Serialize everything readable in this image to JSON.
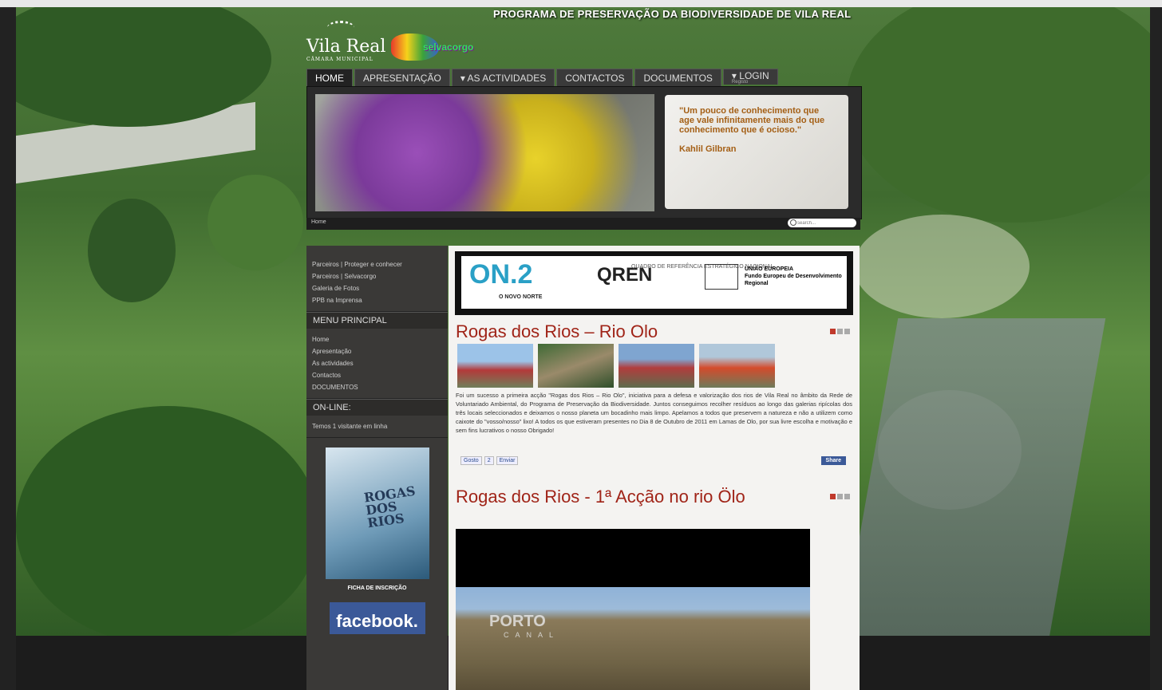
{
  "banner": {
    "title": "PROGRAMA DE PRESERVAÇÃO DA BIODIVERSIDADE DE VILA REAL"
  },
  "logos": {
    "vila_real": "Vila Real",
    "vila_real_sub": "CÂMARA MUNICIPAL",
    "selvacorgo": "selvacorgo"
  },
  "nav": {
    "home": "HOME",
    "apresentacao": "APRESENTAÇÃO",
    "actividades": "AS ACTIVIDADES",
    "contactos": "CONTACTOS",
    "documentos": "DOCUMENTOS",
    "login": "LOGIN",
    "login_sub": "Registo",
    "dropdown_mark": "▾"
  },
  "quote": {
    "text": "\"Um pouco de conhecimento que age vale infinitamente mais do que conhecimento que é ocioso.\"",
    "author": "Kahlil Gilbran"
  },
  "breadcrumb": {
    "label": "Home"
  },
  "search": {
    "placeholder": "search..."
  },
  "sidebar": {
    "links": [
      "Parceiros | Proteger e conhecer",
      "Parceiros | Selvacorgo",
      "Galeria de Fotos",
      "PPB na Imprensa"
    ],
    "menu_heading": "MENU PRINCIPAL",
    "menu_items": [
      "Home",
      "Apresentação",
      "As actividades",
      "Contactos",
      "DOCUMENTOS"
    ],
    "online_heading": "ON-LINE:",
    "online_text": "Temos 1 visitante em linha",
    "poster_title": "ROGAS DOS RIOS",
    "ficha": "FICHA DE INSCRIÇÃO",
    "facebook": "facebook."
  },
  "partners": {
    "on2": "ON.2",
    "on2_sub": "O NOVO NORTE",
    "qren": "QREN",
    "qren_sub": "QUADRO DE REFERÊNCIA ESTRATÉGICO NACIONAL",
    "eu": "UNIÃO EUROPEIA",
    "eu_sub": "Fundo Europeu de Desenvolvimento Regional"
  },
  "article1": {
    "title": "Rogas dos Rios – Rio Olo",
    "text": "Foi um sucesso a primeira acção \"Rogas dos Rios – Rio Olo\", iniciativa para a defesa e valorização dos rios de Vila Real no âmbito da Rede de Voluntariado Ambiental, do Programa de Preservação da Biodiversidade. Juntos conseguimos recolher resíduos ao longo das galerias ripícolas dos três locais seleccionados e deixamos o nosso planeta um bocadinho mais limpo. Apelamos a todos que preservem a natureza e não a utilizem como caixote do \"vosso/nosso\" lixo! A todos os que estiveram presentes no Dia 8 de Outubro de 2011 em Lamas de Olo, por sua livre escolha e motivação e sem fins lucrativos o nosso Obrigado!",
    "like": "Gosto",
    "like_count": "2",
    "send": "Enviar",
    "share": "Share"
  },
  "article2": {
    "title": "Rogas dos Rios - 1ª Acção no rio Ölo"
  },
  "video": {
    "channel": "PORTO",
    "channel_sub": "CANAL"
  },
  "colors": {
    "title_red": "#a02418",
    "quote_brown": "#a45f15",
    "facebook_blue": "#3b5998"
  }
}
